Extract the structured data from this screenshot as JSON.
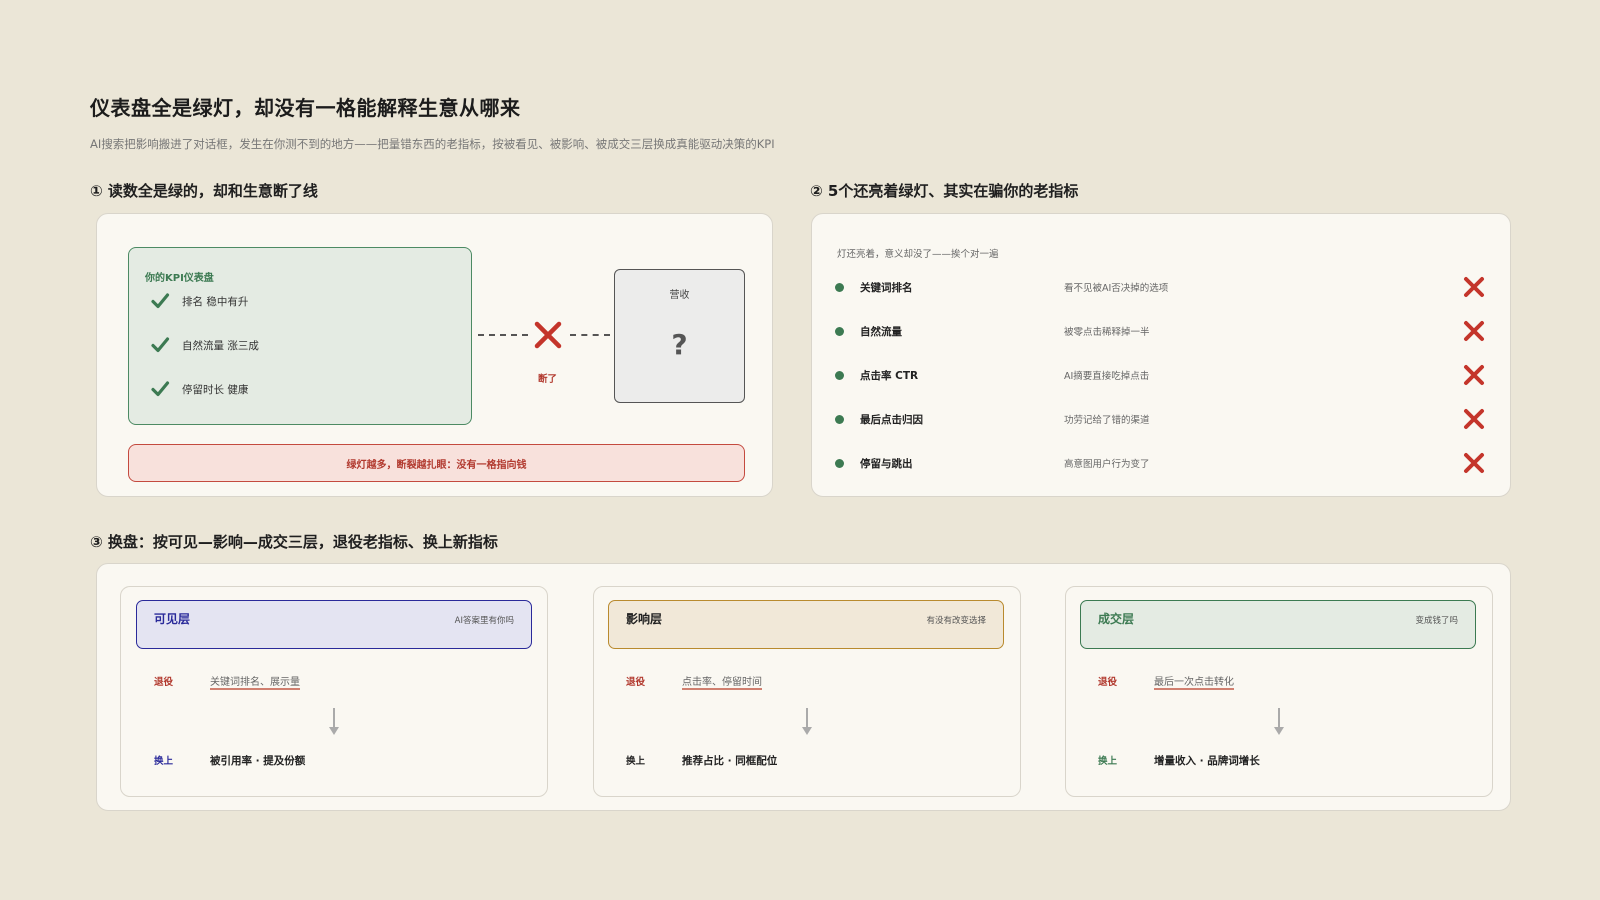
{
  "header": {
    "title": "仪表盘全是绿灯，却没有一格能解释生意从哪来",
    "subtitle": "AI搜索把影响搬进了对话框，发生在你测不到的地方——把量错东西的老指标，按被看见、被影响、被成交三层换成真能驱动决策的KPI"
  },
  "section1": {
    "heading": "① 读数全是绿的，却和生意断了线",
    "kpi_title": "你的KPI仪表盘",
    "kpi_items": [
      "排名 稳中有升",
      "自然流量 涨三成",
      "停留时长 健康"
    ],
    "break_label": "断了",
    "revenue_label": "营收",
    "revenue_mark": "?",
    "alert": "绿灯越多，断裂越扎眼：没有一格指向钱"
  },
  "section2": {
    "heading": "② 5个还亮着绿灯、其实在骗你的老指标",
    "hint": "灯还亮着，意义却没了——挨个对一遍",
    "indicators": [
      {
        "name": "关键词排名",
        "reason": "看不见被AI否决掉的选项"
      },
      {
        "name": "自然流量",
        "reason": "被零点击稀释掉一半"
      },
      {
        "name": "点击率 CTR",
        "reason": "AI摘要直接吃掉点击"
      },
      {
        "name": "最后点击归因",
        "reason": "功劳记给了错的渠道"
      },
      {
        "name": "停留与跳出",
        "reason": "高意图用户行为变了"
      }
    ]
  },
  "section3": {
    "heading": "③ 换盘：按可见—影响—成交三层，退役老指标、换上新指标",
    "layers": [
      {
        "name": "可见层",
        "question": "AI答案里有你吗",
        "retire_label": "退役",
        "retire": "关键词排名、展示量",
        "replace_label": "换上",
        "replace": "被引用率 · 提及份额"
      },
      {
        "name": "影响层",
        "question": "有没有改变选择",
        "retire_label": "退役",
        "retire": "点击率、停留时间",
        "replace_label": "换上",
        "replace": "推荐占比 · 同框配位"
      },
      {
        "name": "成交层",
        "question": "变成钱了吗",
        "retire_label": "退役",
        "retire": "最后一次点击转化",
        "replace_label": "换上",
        "replace": "增量收入 · 品牌词增长"
      }
    ]
  },
  "colors": {
    "background": "#ebe6d7",
    "green": "#3c7a52",
    "red": "#c4352b",
    "visible_layer": "#2a2a9a",
    "influence_layer": "#b98a2e",
    "deal_layer": "#3c7a52"
  }
}
